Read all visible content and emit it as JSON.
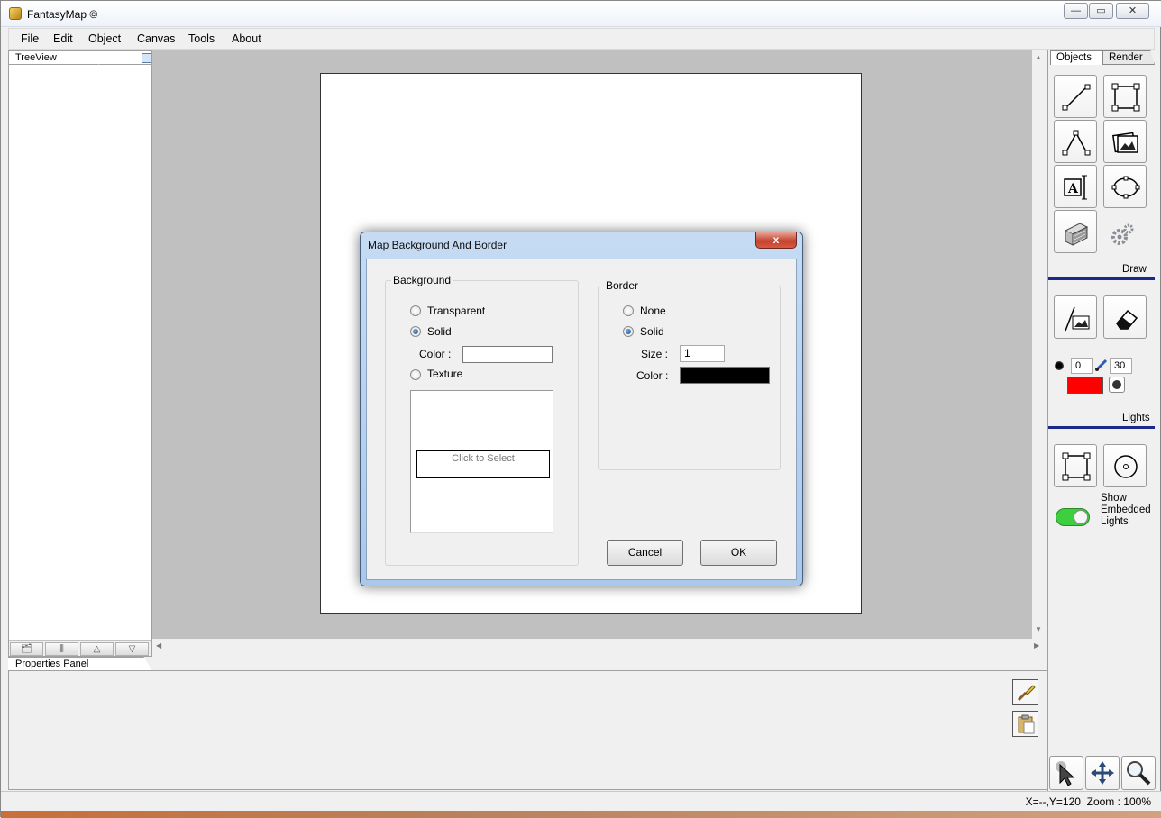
{
  "window": {
    "title": "FantasyMap ©",
    "min_label": "—",
    "max_label": "▭",
    "close_label": "✕"
  },
  "menu": [
    "File",
    "Edit",
    "Object",
    "Canvas",
    "Tools",
    "About"
  ],
  "tree_panel": {
    "tab": "TreeView",
    "toolbar": [
      "🗂",
      "⫼",
      "△",
      "▽"
    ]
  },
  "properties_panel": {
    "tab": "Properties Panel"
  },
  "right_panel": {
    "tabs": [
      "Objects",
      "Render"
    ],
    "draw_label": "Draw",
    "lights_label": "Lights",
    "light_radius_min": "0",
    "light_radius_max": "30",
    "light_color": "#ff0000",
    "show_embedded": "Show Embedded Lights",
    "toggle_color": "#3ecf3e"
  },
  "status": {
    "coords": "X=--,Y=120",
    "zoom": "Zoom : 100%"
  },
  "dialog": {
    "title": "Map Background And Border",
    "close": "x",
    "background": {
      "title": "Background",
      "options": [
        "Transparent",
        "Solid",
        "Texture"
      ],
      "selected": "Solid",
      "color_label": "Color :",
      "color_value": "#ffffff",
      "texture_button": "Click to Select"
    },
    "border": {
      "title": "Border",
      "options": [
        "None",
        "Solid"
      ],
      "selected": "Solid",
      "size_label": "Size :",
      "size_value": "1",
      "color_label": "Color :",
      "color_value": "#000000"
    },
    "cancel": "Cancel",
    "ok": "OK"
  }
}
